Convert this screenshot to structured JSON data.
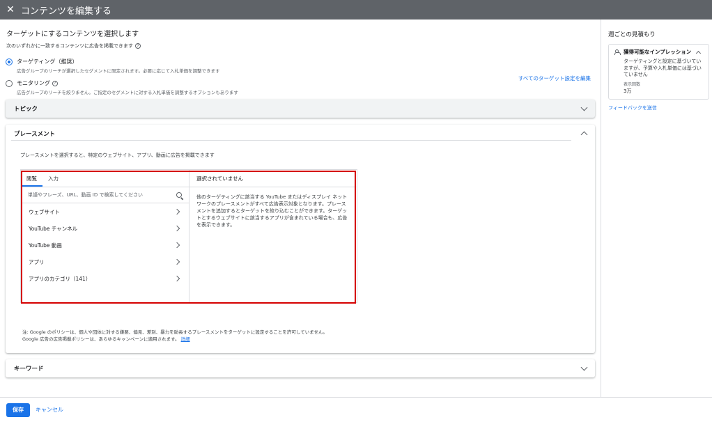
{
  "header": {
    "title": "コンテンツを編集する"
  },
  "main": {
    "heading": "ターゲットにするコンテンツを選択します",
    "subheading": "次のいずれかに一致するコンテンツに広告を掲載できます",
    "options": [
      {
        "label": "ターゲティング（推奨）",
        "desc": "広告グループのリーチが選択したセグメントに限定されます。必要に応じて入札単価を調整できます",
        "selected": true
      },
      {
        "label": "モニタリング",
        "desc": "広告グループのリーチを絞りません。ご指定のセグメントに対する入札単価を調整するオプションもあります",
        "selected": false
      }
    ],
    "edit_all_link": "すべてのターゲット設定を編集",
    "topic_label": "トピック",
    "placement": {
      "label": "プレースメント",
      "desc": "プレースメントを選択すると、特定のウェブサイト、アプリ、動画に広告を掲載できます",
      "tabs": [
        "閲覧",
        "入力"
      ],
      "search_placeholder": "単語やフレーズ、URL、動画 ID で検索してください",
      "items": [
        "ウェブサイト",
        "YouTube チャンネル",
        "YouTube 動画",
        "アプリ",
        "アプリのカテゴリ（141）"
      ],
      "selected_header": "選択されていません",
      "selected_desc": "他のターゲティングに該当する YouTube またはディスプレイ ネットワークのプレースメントがすべて広告表示対象となります。プレースメントを追加するとターゲットを絞り込むことができます。ターゲットとするウェブサイトに該当するアプリが含まれている場合も、広告を表示できます。",
      "note_line1": "注: Google のポリシーは、個人や団体に対する嫌悪、偏見、差別、暴力を助長するプレースメントをターゲットに設定することを許可していません。",
      "note_line2": "Google 広告の広告掲載ポリシーは、あらゆるキャンペーンに適用されます。",
      "note_link": "詳細"
    },
    "keyword_label": "キーワード"
  },
  "side": {
    "title": "週ごとの見積もり",
    "card_title": "獲得可能なインプレッション",
    "card_desc": "ターゲティングと設定に基づいていますが、予算や入札単価には基づいていません",
    "metric_label": "表示回数",
    "metric_value": "3万",
    "feedback": "フィードバックを送信"
  },
  "footer": {
    "save": "保存",
    "cancel": "キャンセル"
  },
  "colors": {
    "accent": "#1a73e8",
    "highlight": "#d50000",
    "topbar": "#5f6368"
  }
}
